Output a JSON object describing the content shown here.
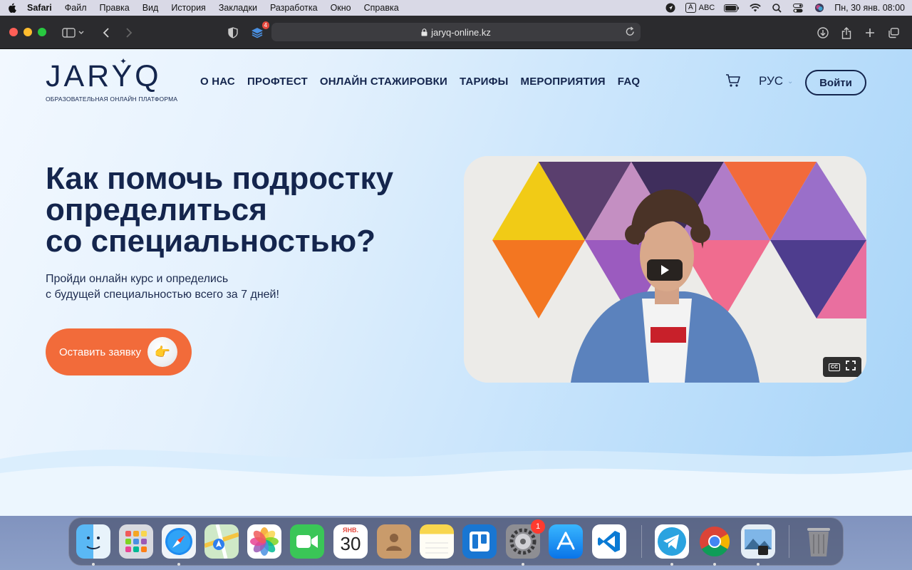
{
  "menubar": {
    "app_name": "Safari",
    "items": [
      "Файл",
      "Правка",
      "Вид",
      "История",
      "Закладки",
      "Разработка",
      "Окно",
      "Справка"
    ],
    "input_letter": "A",
    "input_source": "ABC",
    "datetime": "Пн, 30 янв.  08:00"
  },
  "safari": {
    "url": "jaryq-online.kz",
    "extension_badge": "4"
  },
  "site": {
    "logo_text": "JARYQ",
    "logo_tagline": "ОБРАЗОВАТЕЛЬНАЯ ОНЛАЙН ПЛАТФОРМА",
    "nav": [
      "О НАС",
      "ПРОФТЕСТ",
      "ОНЛАЙН СТАЖИРОВКИ",
      "ТАРИФЫ",
      "МЕРОПРИЯТИЯ",
      "FAQ"
    ],
    "language": "РУС",
    "login_label": "Войти",
    "hero": {
      "title_lines": [
        "Как помочь подростку",
        "определиться",
        "со специальностью?"
      ],
      "subtitle_lines": [
        "Пройди онлайн курс и определись",
        "с будущей специальностью всего за 7 дней!"
      ],
      "cta_label": "Оставить заявку"
    },
    "video": {
      "cc_label": "CC"
    }
  },
  "dock": {
    "apps": [
      "Finder",
      "Launchpad",
      "Safari",
      "Maps",
      "Photos",
      "FaceTime",
      "Calendar",
      "Contacts",
      "Notes",
      "Trello",
      "System Settings",
      "App Store",
      "Visual Studio Code",
      "Telegram",
      "Google Chrome",
      "Preview",
      "Trash"
    ],
    "calendar_month": "ЯНВ.",
    "calendar_day": "30",
    "settings_badge": "1"
  },
  "colors": {
    "brand_navy": "#14254d",
    "cta_orange": "#f26b3a",
    "page_blue": "#bfe0fb"
  }
}
